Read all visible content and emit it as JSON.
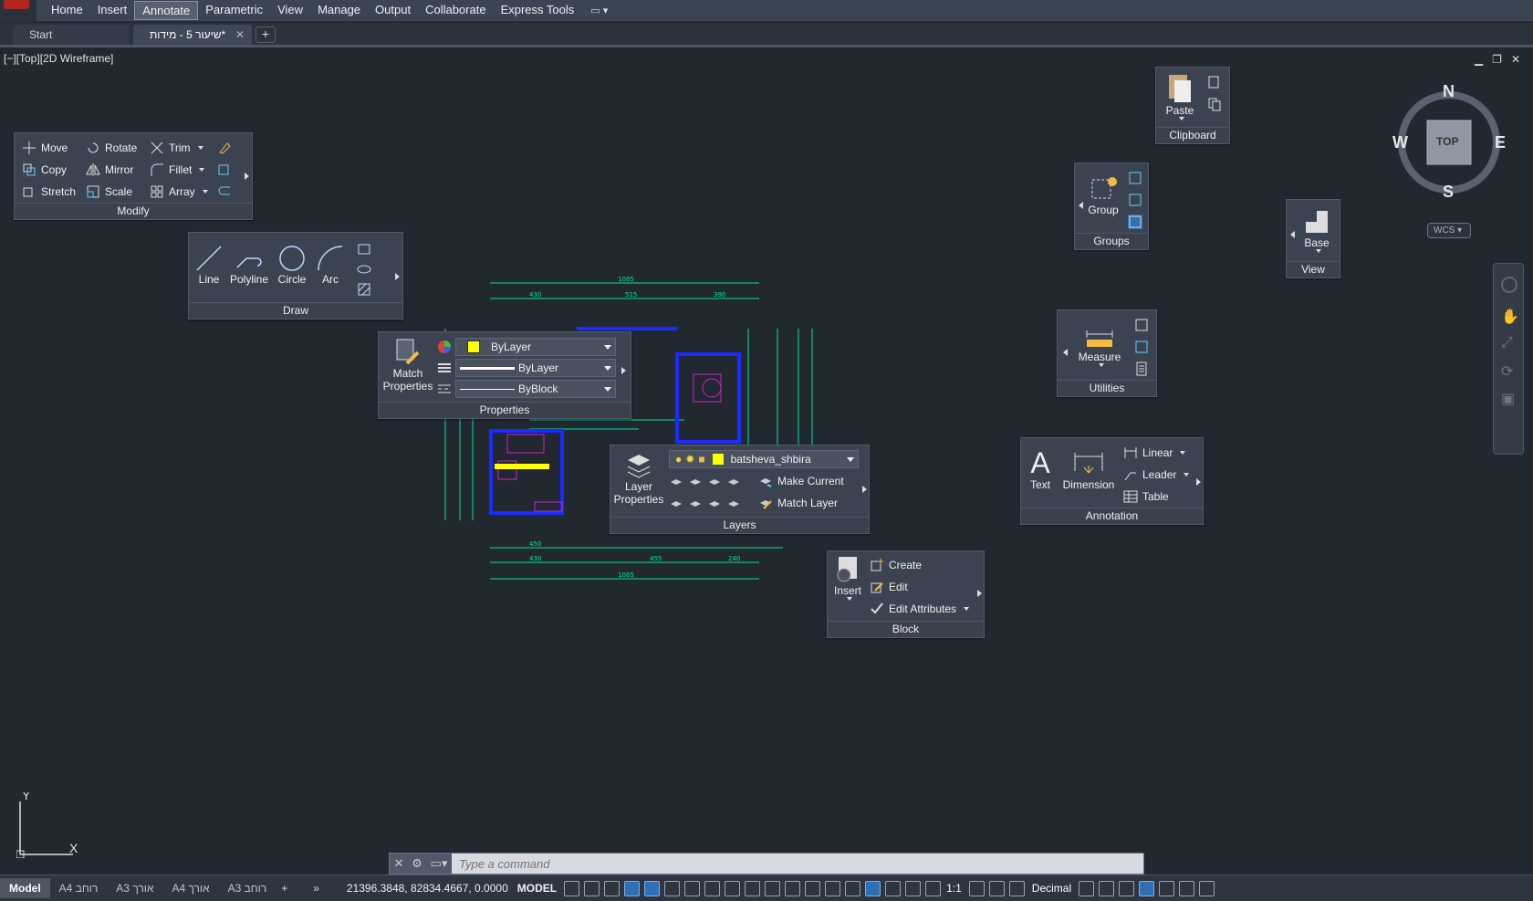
{
  "menu": [
    "Home",
    "Insert",
    "Annotate",
    "Parametric",
    "View",
    "Manage",
    "Output",
    "Collaborate",
    "Express Tools"
  ],
  "menu_active": "Annotate",
  "tabs": {
    "start": "Start",
    "drawing": "שיעור 5 - מידות*",
    "close": "✕",
    "new": "+"
  },
  "viewport": {
    "label": "[−][Top][2D Wireframe]",
    "minimize": "▁",
    "restore": "❐",
    "close": "✕"
  },
  "modify": {
    "title": "Modify",
    "move": "Move",
    "rotate": "Rotate",
    "trim": "Trim",
    "copy": "Copy",
    "mirror": "Mirror",
    "fillet": "Fillet",
    "stretch": "Stretch",
    "scale": "Scale",
    "array": "Array"
  },
  "draw": {
    "title": "Draw",
    "line": "Line",
    "polyline": "Polyline",
    "circle": "Circle",
    "arc": "Arc"
  },
  "properties": {
    "title": "Properties",
    "match": "Match Properties",
    "color": "ByLayer",
    "lineweight": "ByLayer",
    "linetype": "ByBlock",
    "accent_color": "#ffff00"
  },
  "layers": {
    "title": "Layers",
    "layer_props": "Layer Properties",
    "current_layer": "batsheva_shbira",
    "make_current": "Make Current",
    "match_layer": "Match Layer"
  },
  "block": {
    "title": "Block",
    "insert": "Insert",
    "create": "Create",
    "edit": "Edit",
    "edit_attr": "Edit Attributes"
  },
  "annotation": {
    "title": "Annotation",
    "text": "Text",
    "dimension": "Dimension",
    "linear": "Linear",
    "leader": "Leader",
    "table": "Table"
  },
  "clipboard": {
    "title": "Clipboard",
    "paste": "Paste"
  },
  "groups": {
    "title": "Groups",
    "group": "Group"
  },
  "view": {
    "title": "View",
    "base": "Base"
  },
  "utilities": {
    "title": "Utilities",
    "measure": "Measure"
  },
  "compass": {
    "n": "N",
    "s": "S",
    "e": "E",
    "w": "W",
    "top": "TOP",
    "wcs": "WCS"
  },
  "ucs": {
    "x": "X",
    "y": "Y"
  },
  "command": {
    "placeholder": "Type a command"
  },
  "status": {
    "layouts": [
      "Model",
      "A4 רוחב",
      "A3 אורך",
      "A4 אורך",
      "A3 רוחב"
    ],
    "coords": "21396.3848, 82834.4667, 0.0000",
    "mode": "MODEL",
    "scale": "1:1",
    "units": "Decimal"
  },
  "dims": {
    "top1": "1085",
    "top2a": "430",
    "top2b": "515",
    "top2c": "390",
    "bot1": "450",
    "bot2": "430",
    "bot3": "455",
    "bot4": "240",
    "bot5": "1085"
  }
}
